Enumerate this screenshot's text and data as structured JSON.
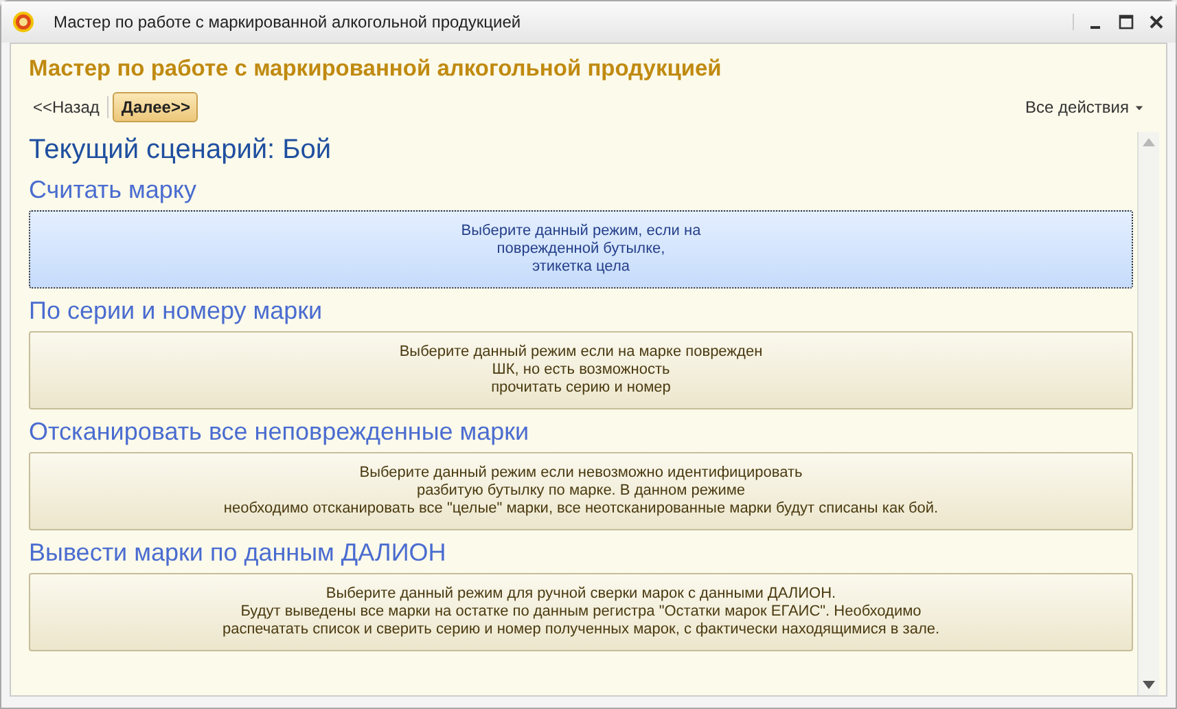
{
  "window": {
    "title": "Мастер по работе с маркированной алкогольной продукцией"
  },
  "header": {
    "title": "Мастер по работе с маркированной алкогольной продукцией"
  },
  "toolbar": {
    "back": "<<Назад",
    "next": "Далее>>",
    "all_actions": "Все действия"
  },
  "scenario": "Текущий сценарий: Бой",
  "modes": [
    {
      "title": "Считать марку",
      "description": "Выберите данный режим, если на\nповрежденной бутылке,\nэтикетка цела",
      "selected": true
    },
    {
      "title": "По серии и номеру марки",
      "description": "Выберите данный режим если на марке поврежден\nШК, но есть возможность\nпрочитать серию и номер",
      "selected": false
    },
    {
      "title": "Отсканировать все неповрежденные марки",
      "description": "Выберите данный режим если невозможно идентифицировать\nразбитую бутылку по марке. В данном режиме\nнеобходимо отсканировать все \"целые\" марки, все неотсканированные марки будут списаны как бой.",
      "selected": false
    },
    {
      "title": "Вывести марки по данным ДАЛИОН",
      "description": "Выберите данный режим для ручной сверки марок с данными ДАЛИОН.\nБудут выведены все марки на остатке по данным регистра \"Остатки марок ЕГАИС\". Необходимо\nраспечатать список и сверить серию и номер полученных марок, с фактически находящимися в зале.",
      "selected": false
    }
  ]
}
